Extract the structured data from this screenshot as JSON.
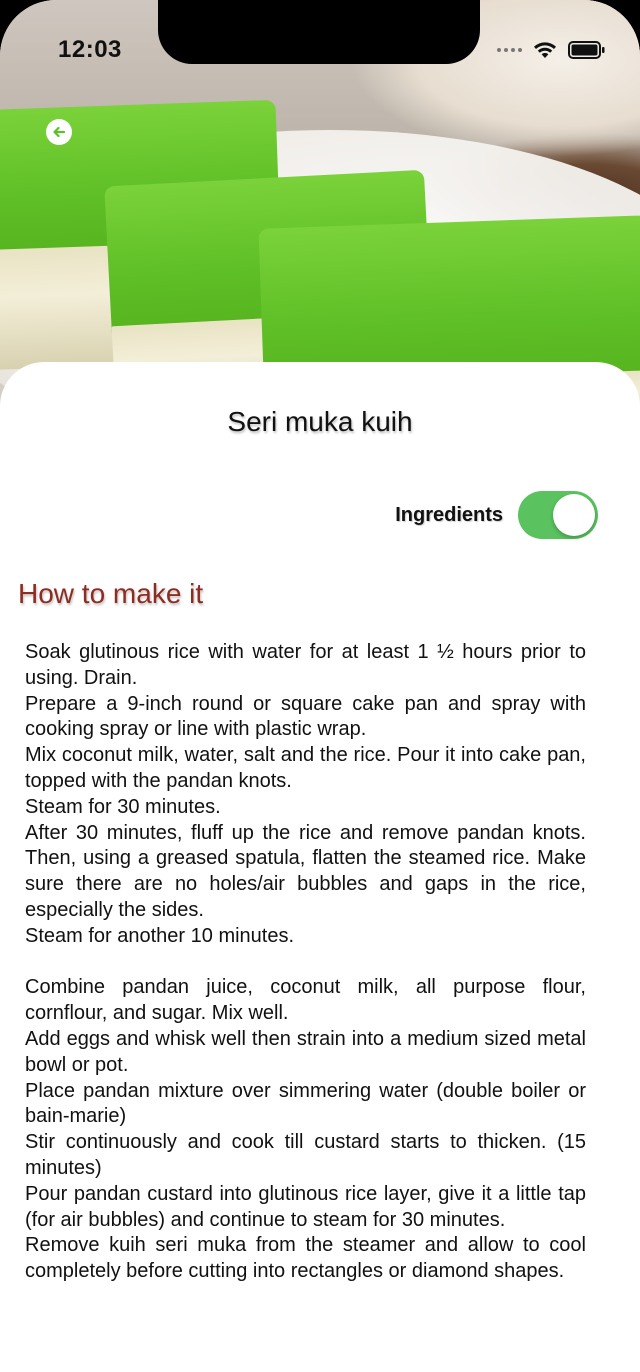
{
  "status_bar": {
    "time": "12:03"
  },
  "header": {
    "back_icon": "arrow-left-icon"
  },
  "recipe": {
    "title": "Seri muka kuih",
    "toggle_label": "Ingredients",
    "toggle_on": true,
    "section_heading": "How to make it",
    "steps_part1": [
      "Soak glutinous rice with water for at least 1 ½ hours prior to using. Drain.",
      "Prepare a 9-inch round or square cake pan and spray with cooking spray or line with plastic wrap.",
      "Mix coconut milk, water, salt and the rice. Pour it into cake pan, topped with the pandan knots.",
      "Steam for 30 minutes.",
      "After 30 minutes, fluff up the rice and remove pandan knots. Then, using a greased spatula, flatten the steamed rice. Make sure there are no holes/air bubbles and gaps in the rice, especially the sides.",
      "Steam for another 10 minutes."
    ],
    "steps_part2": [
      "Combine pandan juice, coconut milk, all purpose flour, cornflour, and sugar. Mix well.",
      "Add eggs and whisk well then strain into a medium sized metal bowl or pot.",
      "Place pandan mixture over simmering water (double boiler or bain-marie)",
      "Stir continuously and cook till custard starts to thicken. (15 minutes)",
      "Pour pandan custard into glutinous rice layer, give it a little tap (for air bubbles) and continue to steam for 30 minutes.",
      "Remove kuih seri muka from the steamer and allow to cool completely before cutting into rectangles or diamond shapes."
    ]
  },
  "colors": {
    "toggle_on": "#5ac35f",
    "section_heading": "#8f2c22",
    "kuih_green": "#5fbf26"
  }
}
